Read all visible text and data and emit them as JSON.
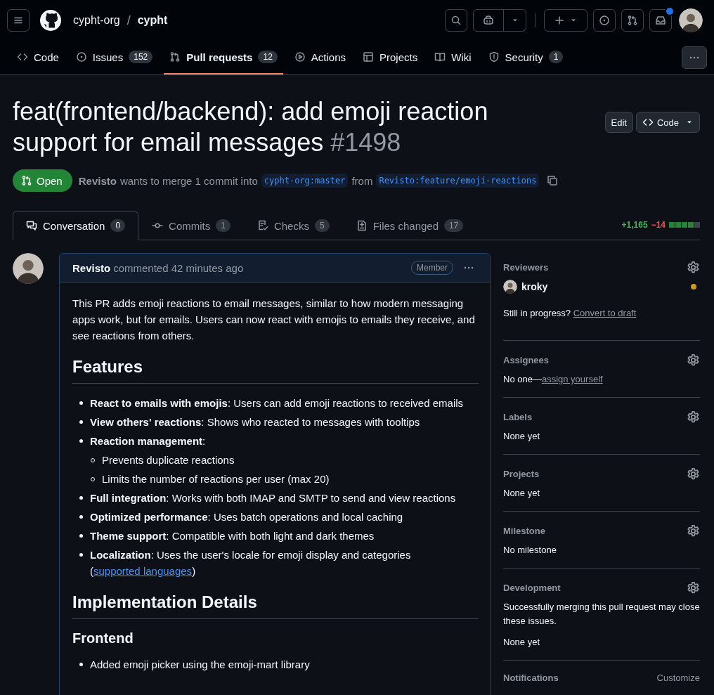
{
  "header": {
    "owner": "cypht-org",
    "separator": "/",
    "repo": "cypht",
    "inbox_unread": true
  },
  "repo_tabs": [
    {
      "label": "Code",
      "selected": false
    },
    {
      "label": "Issues",
      "count": "152",
      "selected": false
    },
    {
      "label": "Pull requests",
      "count": "12",
      "selected": true
    },
    {
      "label": "Actions",
      "selected": false
    },
    {
      "label": "Projects",
      "selected": false
    },
    {
      "label": "Wiki",
      "selected": false
    },
    {
      "label": "Security",
      "count": "1",
      "selected": false
    }
  ],
  "pr": {
    "title": "feat(frontend/backend): add emoji reaction support for email messages",
    "number": "#1498",
    "edit_button": "Edit",
    "code_button": "Code",
    "status": {
      "label": "Open",
      "kind": "open"
    },
    "author": "Revisto",
    "merge_text": "wants to merge 1 commit into",
    "base": "cypht-org:master",
    "from_text": "from",
    "head": "Revisto:feature/emoji-reactions"
  },
  "pr_tabs": [
    {
      "label": "Conversation",
      "count": "0",
      "selected": true
    },
    {
      "label": "Commits",
      "count": "1",
      "selected": false
    },
    {
      "label": "Checks",
      "count": "5",
      "selected": false
    },
    {
      "label": "Files changed",
      "count": "17",
      "selected": false
    }
  ],
  "diffstat": {
    "additions": "+1,165",
    "deletions": "−14",
    "blocks": [
      {
        "added": true
      },
      {
        "added": true
      },
      {
        "added": true
      },
      {
        "added": true
      },
      {
        "added": false
      }
    ]
  },
  "comment": {
    "author": "Revisto",
    "action": "commented 42 minutes ago",
    "badge": "Member",
    "body": [
      {
        "kind": "paragraph",
        "text": "This PR adds emoji reactions to email messages, similar to how modern messaging apps work, but for emails. Users can now react with emojis to emails they receive, and see reactions from others."
      },
      {
        "kind": "h2",
        "text": "Features"
      },
      {
        "kind": "list",
        "items": [
          {
            "text": "**React to emails with emojis**: Users can add emoji reactions to received emails"
          },
          {
            "text": "**View others' reactions**: Shows who reacted to messages with tooltips"
          },
          {
            "text": "**Reaction management**:",
            "children": [
              {
                "text": "Prevents duplicate reactions"
              },
              {
                "text": "Limits the number of reactions per user (max 20)"
              }
            ]
          },
          {
            "text": "**Full integration**: Works with both IMAP and SMTP to send and view reactions"
          },
          {
            "text": "**Optimized performance**: Uses batch operations and local caching"
          },
          {
            "text": "**Theme support**: Compatible with both light and dark themes"
          },
          {
            "text": "**Localization**: Uses the user's locale for emoji display and categories (",
            "link": "supported languages",
            "text_after": ")"
          }
        ]
      },
      {
        "kind": "h2",
        "text": "Implementation Details"
      },
      {
        "kind": "h3",
        "text": "Frontend"
      },
      {
        "kind": "list",
        "items": [
          {
            "text": "Added emoji picker using the emoji-mart library"
          }
        ]
      }
    ]
  },
  "sidebar": [
    {
      "title": "Reviewers",
      "reviewers": [
        {
          "name": "kroky",
          "review_pending": true
        }
      ],
      "note": "Still in progress?",
      "note_link": "Convert to draft"
    },
    {
      "title": "Assignees",
      "value": "No one—",
      "value_link": "assign yourself"
    },
    {
      "title": "Labels",
      "value": "None yet"
    },
    {
      "title": "Projects",
      "value": "None yet"
    },
    {
      "title": "Milestone",
      "value": "No milestone"
    },
    {
      "title": "Development",
      "note": "Successfully merging this pull request may close these issues.",
      "value": "None yet"
    },
    {
      "title": "Notifications",
      "action": "Customize"
    }
  ]
}
